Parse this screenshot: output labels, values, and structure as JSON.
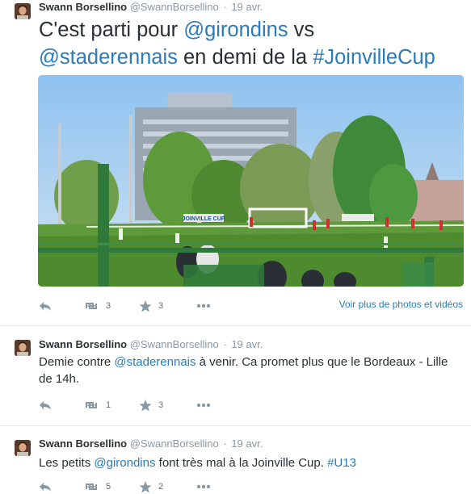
{
  "tweets": [
    {
      "name": "Swann Borsellino",
      "handle": "@SwannBorsellino",
      "separator": "·",
      "time": "19 avr.",
      "text_parts": {
        "p1": "C'est parti pour ",
        "m1": "@girondins",
        "p2": " vs ",
        "m2": "@staderennais",
        "p3": " en demi de la ",
        "h1": "#JoinvilleCup"
      },
      "retweets": "3",
      "favorites": "3",
      "media_link": "Voir plus de photos et vidéos"
    },
    {
      "name": "Swann Borsellino",
      "handle": "@SwannBorsellino",
      "separator": "·",
      "time": "19 avr.",
      "text_parts": {
        "p1": "Demie contre ",
        "m1": "@staderennais",
        "p2": " à venir. Ca promet plus que le Bordeaux - Lille de 14h."
      },
      "retweets": "1",
      "favorites": "3"
    },
    {
      "name": "Swann Borsellino",
      "handle": "@SwannBorsellino",
      "separator": "·",
      "time": "19 avr.",
      "text_parts": {
        "p1": "Les petits ",
        "m1": "@girondins",
        "p2": " font très mal à la Joinville Cup. ",
        "h1": "#U13"
      },
      "retweets": "5",
      "favorites": "2"
    }
  ],
  "photo_banner": "JOINVILLE CUP",
  "colors": {
    "link": "#2b7bb9",
    "muted": "#8899a6",
    "text": "#292f33",
    "divider": "#e1e8ed"
  },
  "icons": [
    "reply-icon",
    "retweet-icon",
    "favorite-star-icon",
    "more-dots-icon"
  ]
}
